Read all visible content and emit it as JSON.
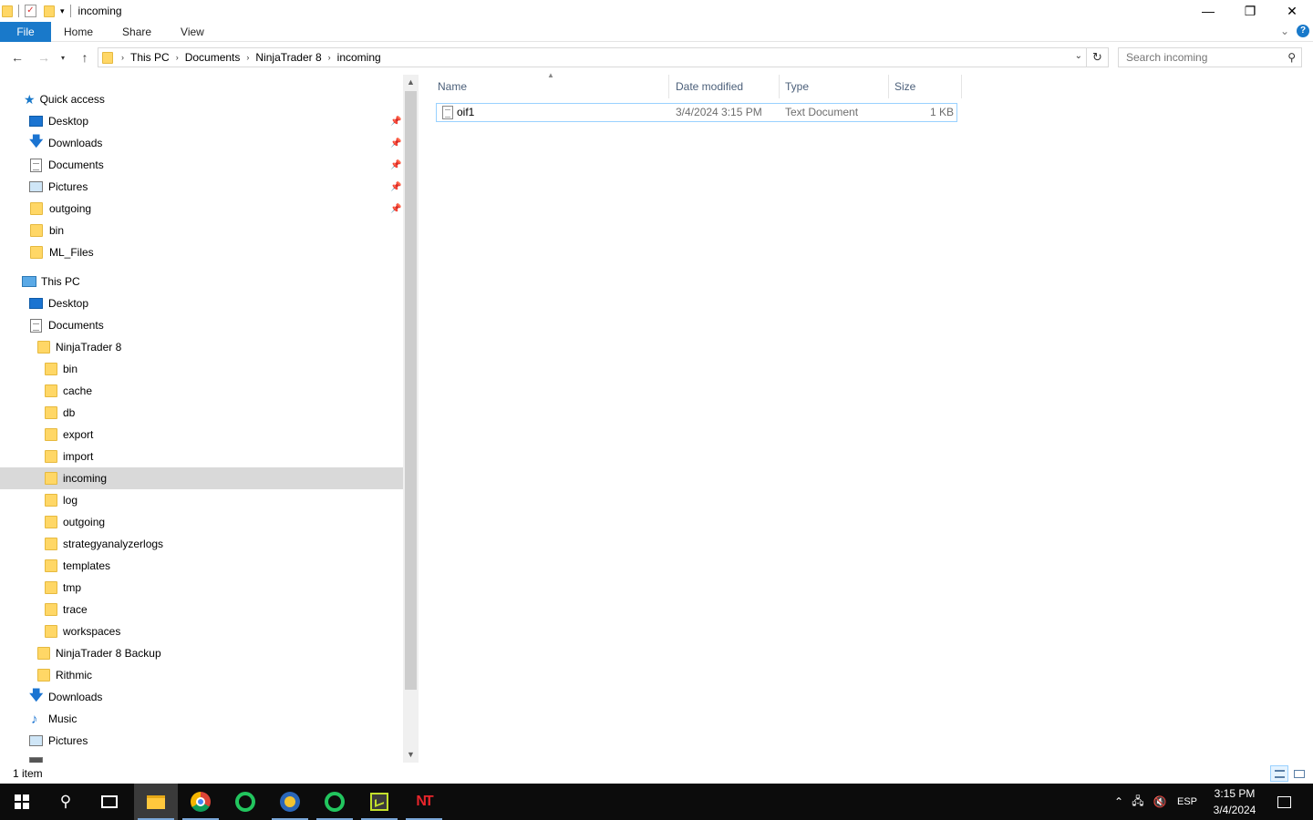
{
  "window": {
    "title": "incoming",
    "minimize_glyph": "—",
    "restore_glyph": "❐",
    "close_glyph": "✕"
  },
  "ribbon": {
    "tabs": [
      "File",
      "Home",
      "Share",
      "View"
    ],
    "expand_glyph": "⌄",
    "help_glyph": "?"
  },
  "address": {
    "breadcrumbs": [
      "This PC",
      "Documents",
      "NinjaTrader 8",
      "incoming"
    ],
    "search_placeholder": "Search incoming"
  },
  "nav": {
    "quick_access_label": "Quick access",
    "quick_access": [
      {
        "label": "Desktop",
        "icon": "desktop-icon",
        "pinned": true
      },
      {
        "label": "Downloads",
        "icon": "downloads-icon",
        "pinned": true
      },
      {
        "label": "Documents",
        "icon": "documents-icon",
        "pinned": true
      },
      {
        "label": "Pictures",
        "icon": "pictures-icon",
        "pinned": true
      },
      {
        "label": "outgoing",
        "icon": "folder-icon",
        "pinned": true
      },
      {
        "label": "bin",
        "icon": "folder-icon",
        "pinned": false
      },
      {
        "label": "ML_Files",
        "icon": "folder-icon",
        "pinned": false
      }
    ],
    "this_pc_label": "This PC",
    "this_pc": [
      {
        "label": "Desktop",
        "icon": "desktop-icon",
        "indent": 1
      },
      {
        "label": "Documents",
        "icon": "documents-icon",
        "indent": 1
      },
      {
        "label": "NinjaTrader 8",
        "icon": "folder-icon",
        "indent": 2
      },
      {
        "label": "bin",
        "icon": "folder-icon",
        "indent": 3
      },
      {
        "label": "cache",
        "icon": "folder-icon",
        "indent": 3
      },
      {
        "label": "db",
        "icon": "folder-icon",
        "indent": 3
      },
      {
        "label": "export",
        "icon": "folder-icon",
        "indent": 3
      },
      {
        "label": "import",
        "icon": "folder-icon",
        "indent": 3
      },
      {
        "label": "incoming",
        "icon": "folder-icon",
        "indent": 3,
        "selected": true
      },
      {
        "label": "log",
        "icon": "folder-icon",
        "indent": 3
      },
      {
        "label": "outgoing",
        "icon": "folder-icon",
        "indent": 3
      },
      {
        "label": "strategyanalyzerlogs",
        "icon": "folder-icon",
        "indent": 3
      },
      {
        "label": "templates",
        "icon": "folder-icon",
        "indent": 3
      },
      {
        "label": "tmp",
        "icon": "folder-icon",
        "indent": 3
      },
      {
        "label": "trace",
        "icon": "folder-icon",
        "indent": 3
      },
      {
        "label": "workspaces",
        "icon": "folder-icon",
        "indent": 3
      },
      {
        "label": "NinjaTrader 8 Backup",
        "icon": "folder-icon",
        "indent": 2
      },
      {
        "label": "Rithmic",
        "icon": "folder-icon",
        "indent": 2
      },
      {
        "label": "Downloads",
        "icon": "downloads-icon",
        "indent": 1
      },
      {
        "label": "Music",
        "icon": "music-icon",
        "indent": 1
      },
      {
        "label": "Pictures",
        "icon": "pictures-icon",
        "indent": 1
      }
    ]
  },
  "files": {
    "columns": [
      "Name",
      "Date modified",
      "Type",
      "Size"
    ],
    "rows": [
      {
        "name": "oif1",
        "date": "3/4/2024 3:15 PM",
        "type": "Text Document",
        "size": "1 KB"
      }
    ]
  },
  "status": {
    "count": "1 item"
  },
  "taskbar": {
    "apps": [
      "start-icon",
      "search-icon",
      "task-view-icon",
      "file-explorer-icon",
      "chrome-icon",
      "green-ring-app-icon",
      "metatrader-icon",
      "green-ring-app-icon",
      "chart-app-icon",
      "ninjatrader-icon"
    ],
    "language": "ESP",
    "time": "3:15 PM",
    "date": "3/4/2024"
  },
  "colors": {
    "accent": "#1979ca",
    "selection": "#d9d9d9",
    "folder": "#ffd766",
    "taskbar": "#0c0c0c"
  }
}
